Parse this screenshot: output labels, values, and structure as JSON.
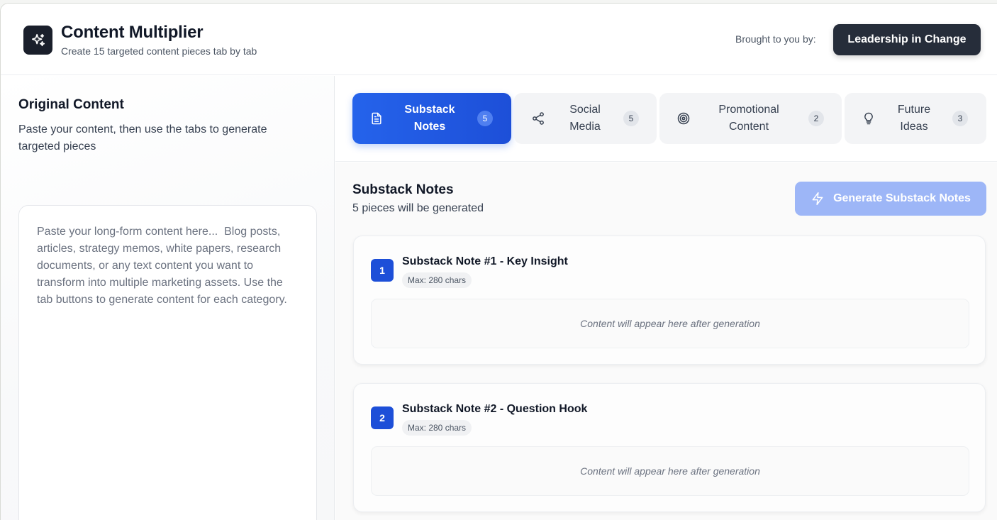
{
  "header": {
    "title": "Content Multiplier",
    "subtitle": "Create 15 targeted content pieces tab by tab",
    "brought_by_label": "Brought to you by:",
    "brand_button": "Leadership in Change",
    "logo_icon": "sparkles-icon"
  },
  "left": {
    "title": "Original Content",
    "description": "Paste your content, then use the tabs to generate targeted pieces",
    "textarea": {
      "value": "",
      "placeholder": "Paste your long-form content here...  Blog posts, articles, strategy memos, white papers, research documents, or any text content you want to transform into multiple marketing assets. Use the tab buttons to generate content for each category."
    }
  },
  "tabs": [
    {
      "label_line1": "Substack",
      "label_line2": "Notes",
      "count": "5",
      "icon": "document-icon",
      "active": true
    },
    {
      "label_line1": "Social",
      "label_line2": "Media",
      "count": "5",
      "icon": "share-icon",
      "active": false
    },
    {
      "label_line1": "Promotional",
      "label_line2": "Content",
      "count": "2",
      "icon": "target-icon",
      "active": false
    },
    {
      "label_line1": "Future",
      "label_line2": "Ideas",
      "count": "3",
      "icon": "lightbulb-icon",
      "active": false
    }
  ],
  "section": {
    "title": "Substack Notes",
    "subtitle": "5 pieces will be generated",
    "generate_button": "Generate Substack Notes",
    "generate_icon": "lightning-icon"
  },
  "notes": [
    {
      "number": "1",
      "title": "Substack Note #1 - Key Insight",
      "max": "Max: 280 chars",
      "placeholder": "Content will appear here after generation"
    },
    {
      "number": "2",
      "title": "Substack Note #2 - Question Hook",
      "max": "Max: 280 chars",
      "placeholder": "Content will appear here after generation"
    }
  ],
  "colors": {
    "accent": "#2563eb",
    "accent_disabled": "#9db6f7",
    "dark": "#262d3a"
  }
}
